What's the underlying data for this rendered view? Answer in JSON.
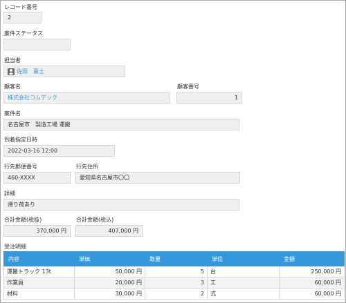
{
  "record_number": {
    "label": "レコード番号",
    "value": "2"
  },
  "deal_status": {
    "label": "案件ステータス",
    "value": ""
  },
  "assignee": {
    "label": "担当者",
    "value": "佐田　薫士"
  },
  "customer_name": {
    "label": "顧客名",
    "value": "株式会社コムデック"
  },
  "customer_number": {
    "label": "顧客番号",
    "value": "1"
  },
  "deal_name": {
    "label": "案件名",
    "value": "名古屋市　製造工場 運搬"
  },
  "arrival_datetime": {
    "label": "到着指定日時",
    "value": "2022-03-16 12:00"
  },
  "dest_postal": {
    "label": "行先郵便番号",
    "value": "460-XXXX"
  },
  "dest_address": {
    "label": "行先住所",
    "value": "愛知県名古屋市〇〇"
  },
  "details": {
    "label": "詳細",
    "value": "帰り荷あり"
  },
  "total_excl_tax": {
    "label": "合計金額(税抜)",
    "value": "370,000 円"
  },
  "total_incl_tax": {
    "label": "合計金額(税込)",
    "value": "407,000 円"
  },
  "order_details": {
    "label": "受注明細",
    "columns": [
      "内容",
      "単価",
      "数量",
      "単位",
      "金額"
    ],
    "rows": [
      {
        "content": "運搬トラック 13t",
        "unit_price": "50,000 円",
        "qty": "5",
        "unit": "台",
        "amount": "250,000 円"
      },
      {
        "content": "作業員",
        "unit_price": "20,000 円",
        "qty": "3",
        "unit": "工",
        "amount": "60,000 円"
      },
      {
        "content": "材料",
        "unit_price": "30,000 円",
        "qty": "2",
        "unit": "式",
        "amount": "60,000 円"
      }
    ]
  },
  "colors": {
    "accent": "#3498db",
    "field_bg": "#f0f0f0",
    "header_text": "#ffffff"
  },
  "icons": {
    "assignee": "user-icon"
  }
}
